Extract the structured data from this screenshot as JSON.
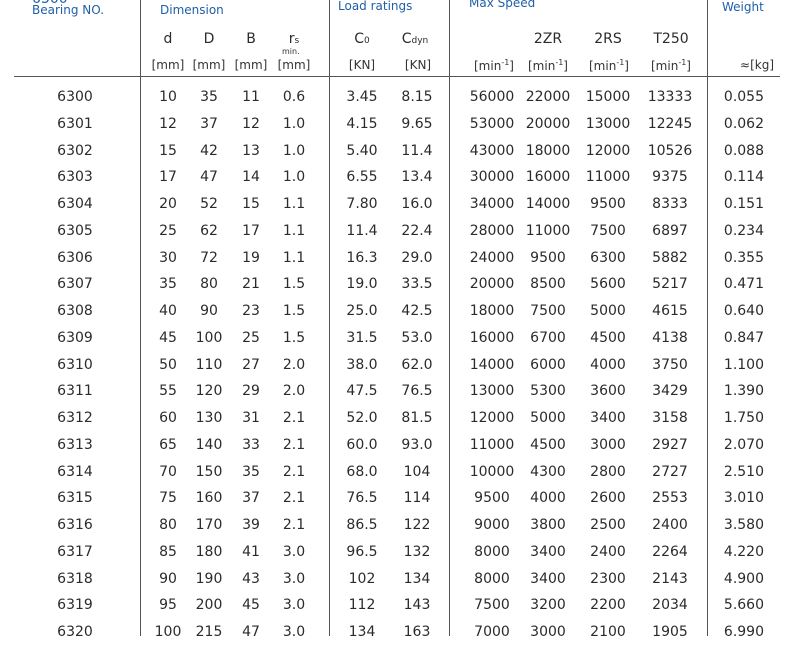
{
  "header": {
    "cut_top_glyphs": "6300",
    "bearing_no": "Bearing NO.",
    "dimension": "Dimension",
    "load_ratings": "Load ratings",
    "max_speed": "Max Speed",
    "weight": "Weight",
    "col_d": "d",
    "col_D": "D",
    "col_B": "B",
    "col_rs": "r",
    "col_rs_sub": "s",
    "col_rs_min": "min.",
    "col_C0": "C",
    "col_C0_sub": "0",
    "col_Cdyn": "C",
    "col_Cdyn_sub": "dyn",
    "col_2ZR": "2ZR",
    "col_2RS": "2RS",
    "col_T250": "T250",
    "unit_mm": "[mm]",
    "unit_kn": "[KN]",
    "unit_min_open": "[min",
    "unit_min_exp": "-1",
    "unit_min_close": "]",
    "unit_kg": "≈[kg]"
  },
  "rows": [
    [
      "6300",
      "10",
      "35",
      "11",
      "0.6",
      "3.45",
      "8.15",
      "56000",
      "22000",
      "15000",
      "13333",
      "0.055"
    ],
    [
      "6301",
      "12",
      "37",
      "12",
      "1.0",
      "4.15",
      "9.65",
      "53000",
      "20000",
      "13000",
      "12245",
      "0.062"
    ],
    [
      "6302",
      "15",
      "42",
      "13",
      "1.0",
      "5.40",
      "11.4",
      "43000",
      "18000",
      "12000",
      "10526",
      "0.088"
    ],
    [
      "6303",
      "17",
      "47",
      "14",
      "1.0",
      "6.55",
      "13.4",
      "30000",
      "16000",
      "11000",
      "9375",
      "0.114"
    ],
    [
      "6304",
      "20",
      "52",
      "15",
      "1.1",
      "7.80",
      "16.0",
      "34000",
      "14000",
      "9500",
      "8333",
      "0.151"
    ],
    [
      "6305",
      "25",
      "62",
      "17",
      "1.1",
      "11.4",
      "22.4",
      "28000",
      "11000",
      "7500",
      "6897",
      "0.234"
    ],
    [
      "6306",
      "30",
      "72",
      "19",
      "1.1",
      "16.3",
      "29.0",
      "24000",
      "9500",
      "6300",
      "5882",
      "0.355"
    ],
    [
      "6307",
      "35",
      "80",
      "21",
      "1.5",
      "19.0",
      "33.5",
      "20000",
      "8500",
      "5600",
      "5217",
      "0.471"
    ],
    [
      "6308",
      "40",
      "90",
      "23",
      "1.5",
      "25.0",
      "42.5",
      "18000",
      "7500",
      "5000",
      "4615",
      "0.640"
    ],
    [
      "6309",
      "45",
      "100",
      "25",
      "1.5",
      "31.5",
      "53.0",
      "16000",
      "6700",
      "4500",
      "4138",
      "0.847"
    ],
    [
      "6310",
      "50",
      "110",
      "27",
      "2.0",
      "38.0",
      "62.0",
      "14000",
      "6000",
      "4000",
      "3750",
      "1.100"
    ],
    [
      "6311",
      "55",
      "120",
      "29",
      "2.0",
      "47.5",
      "76.5",
      "13000",
      "5300",
      "3600",
      "3429",
      "1.390"
    ],
    [
      "6312",
      "60",
      "130",
      "31",
      "2.1",
      "52.0",
      "81.5",
      "12000",
      "5000",
      "3400",
      "3158",
      "1.750"
    ],
    [
      "6313",
      "65",
      "140",
      "33",
      "2.1",
      "60.0",
      "93.0",
      "11000",
      "4500",
      "3000",
      "2927",
      "2.070"
    ],
    [
      "6314",
      "70",
      "150",
      "35",
      "2.1",
      "68.0",
      "104",
      "10000",
      "4300",
      "2800",
      "2727",
      "2.510"
    ],
    [
      "6315",
      "75",
      "160",
      "37",
      "2.1",
      "76.5",
      "114",
      "9500",
      "4000",
      "2600",
      "2553",
      "3.010"
    ],
    [
      "6316",
      "80",
      "170",
      "39",
      "2.1",
      "86.5",
      "122",
      "9000",
      "3800",
      "2500",
      "2400",
      "3.580"
    ],
    [
      "6317",
      "85",
      "180",
      "41",
      "3.0",
      "96.5",
      "132",
      "8000",
      "3400",
      "2400",
      "2264",
      "4.220"
    ],
    [
      "6318",
      "90",
      "190",
      "43",
      "3.0",
      "102",
      "134",
      "8000",
      "3400",
      "2300",
      "2143",
      "4.900"
    ],
    [
      "6319",
      "95",
      "200",
      "45",
      "3.0",
      "112",
      "143",
      "7500",
      "3200",
      "2200",
      "2034",
      "5.660"
    ],
    [
      "6320",
      "100",
      "215",
      "47",
      "3.0",
      "134",
      "163",
      "7000",
      "3000",
      "2100",
      "1905",
      "6.990"
    ]
  ]
}
